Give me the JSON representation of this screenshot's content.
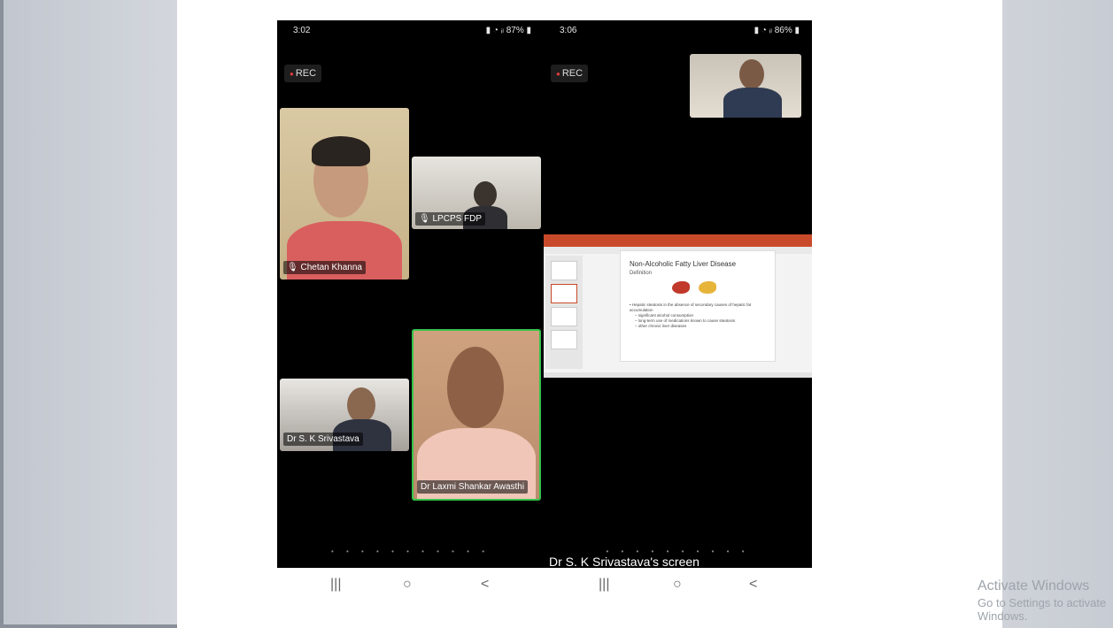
{
  "left_phone": {
    "status_time": "3:02",
    "status_right": "87%",
    "rec_label": "REC",
    "participants": [
      {
        "name": "Chetan Khanna"
      },
      {
        "name": "LPCPS FDP"
      },
      {
        "name": "Dr S. K Srivastava"
      },
      {
        "name": "Dr Laxmi Shankar Awasthi"
      }
    ],
    "page_dots": "• • • • • • • • • • •"
  },
  "right_phone": {
    "status_time": "3:06",
    "status_right": "86%",
    "rec_label": "REC",
    "slide": {
      "title": "Non-Alcoholic Fatty Liver Disease",
      "subtitle": "Definition",
      "bullets": [
        "• Hepatic steatosis in the absence of secondary causes of hepatic fat accumulation",
        "– significant alcohol consumption",
        "– long-term use of medications known to cause steatosis",
        "– other chronic liver diseases"
      ]
    },
    "screen_label": "Dr S. K Srivastava's screen",
    "page_dots": "• • • • • • • • • •"
  },
  "nav": {
    "recents": "|||",
    "home": "○",
    "back": "<"
  },
  "watermark": {
    "line1": "Activate Windows",
    "line2": "Go to Settings to activate Windows."
  }
}
